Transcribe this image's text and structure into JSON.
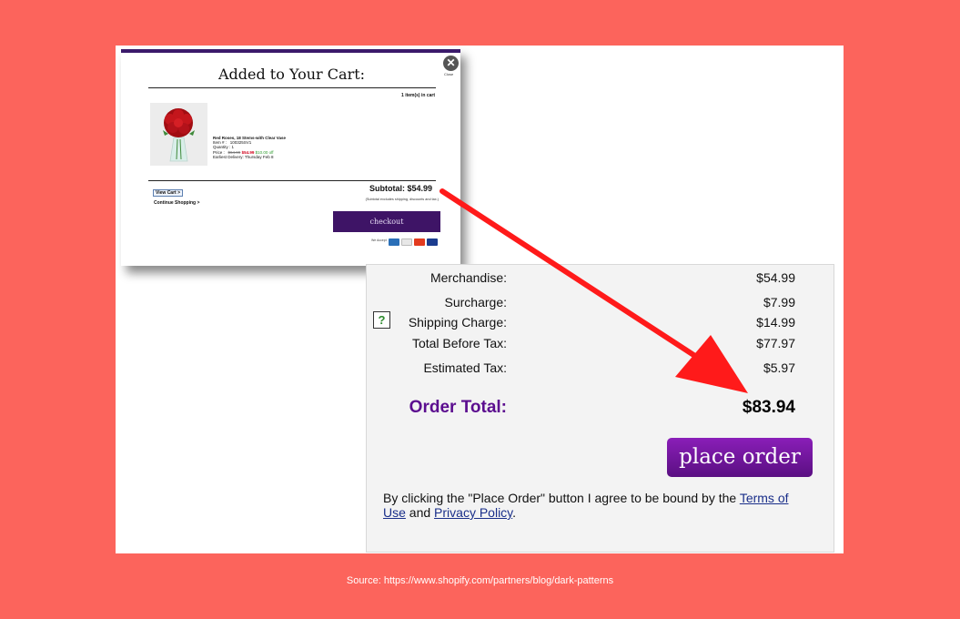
{
  "popup": {
    "title": "Added to Your Cart:",
    "close_label": "Close",
    "items_count": "1 item(s) in cart",
    "product": {
      "name": "Red Roses, 18 Stems-with Clear Vase",
      "item_label": "Item # :",
      "item_number": "100325SV1",
      "quantity_label": "Quantity :",
      "quantity": "1",
      "price_label": "Price :",
      "original_price": "$64.99",
      "sale_price": "$54.99",
      "savings": "$10.00 off",
      "delivery": "Earliest Delivery: Thursday Feb 8"
    },
    "subtotal": "Subtotal:  $54.99",
    "subtotal_note": "(Subtotal excludes shipping, discounts and tax.)",
    "view_cart": "View Cart >",
    "continue_shopping": "Continue Shopping >",
    "checkout": "checkout",
    "we_accept": "We Accept"
  },
  "order": {
    "lines": [
      {
        "label": "Merchandise:",
        "value": "$54.99"
      },
      {
        "label": "Surcharge:",
        "value": "$7.99"
      },
      {
        "label": "Shipping Charge:",
        "value": "$14.99"
      },
      {
        "label": "Total Before Tax:",
        "value": "$77.97"
      },
      {
        "label": "Estimated Tax:",
        "value": "$5.97"
      }
    ],
    "help_icon": "?",
    "total_label": "Order Total:",
    "total_value": "$83.94",
    "place_order": "place order",
    "agree_prefix": "By clicking the \"Place Order\" button I agree to be bound by the ",
    "terms_link": "Terms of Use",
    "agree_and": " and ",
    "privacy_link": "Privacy Policy",
    "agree_suffix": "."
  },
  "source": "Source: https://www.shopify.com/partners/blog/dark-patterns",
  "colors": {
    "background": "#fc645c",
    "checkout": "#3e1466",
    "order_total": "#5b0d8f",
    "place_order": "#7a1aa8",
    "arrow": "#ff1a1a"
  }
}
